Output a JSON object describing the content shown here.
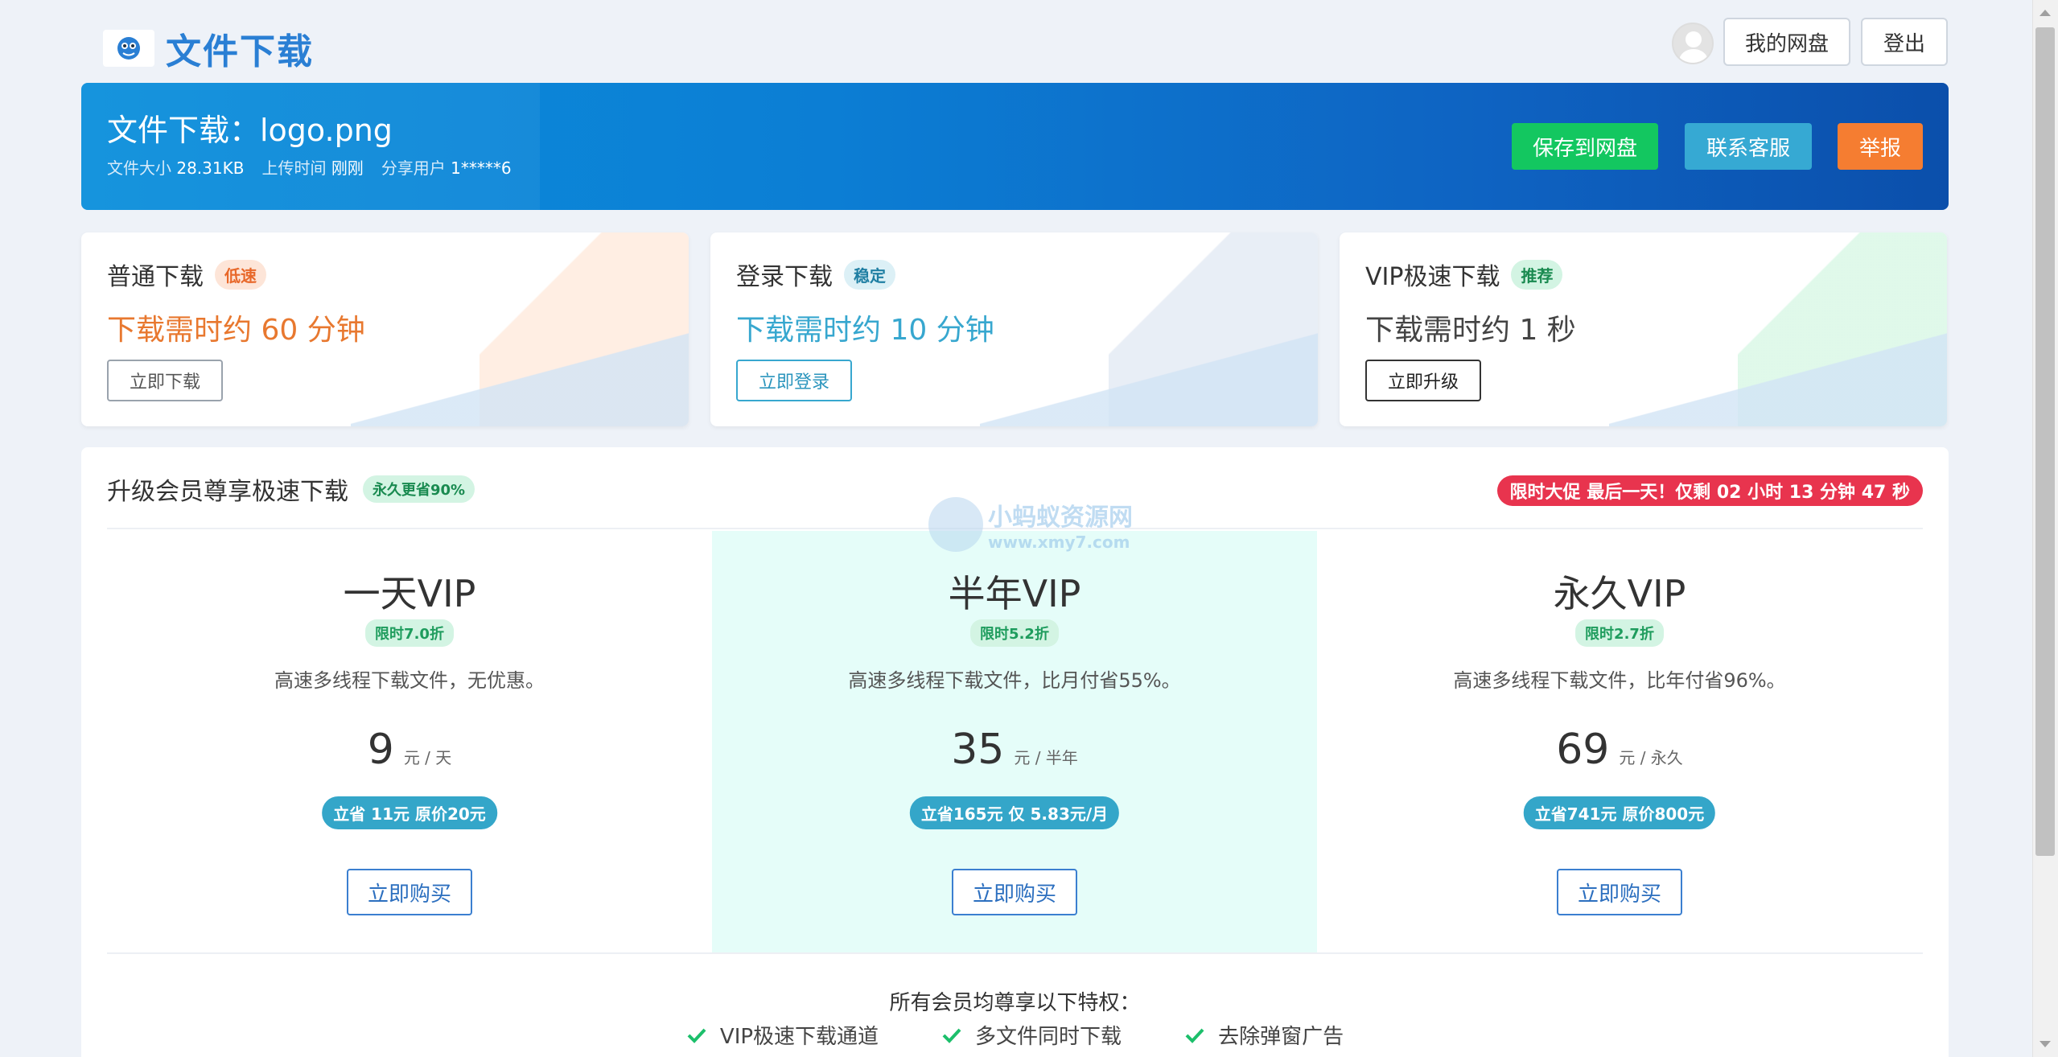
{
  "header": {
    "logo_text": "文件下载",
    "my_drive": "我的网盘",
    "logout": "登出"
  },
  "banner": {
    "title": "文件下载：logo.png",
    "size_label": "文件大小",
    "size_value": "28.31KB",
    "upload_label": "上传时间",
    "upload_value": "刚刚",
    "user_label": "分享用户",
    "user_value": "1*****6",
    "save_btn": "保存到网盘",
    "contact_btn": "联系客服",
    "report_btn": "举报",
    "colors": {
      "save": "#13c760",
      "contact": "#36a9d3",
      "report": "#f57d31"
    }
  },
  "download_options": [
    {
      "title": "普通下载",
      "tag": "低速",
      "time": "下载需时约 60 分钟",
      "button": "立即下载",
      "tag_bg": "#fde5d8",
      "tag_color": "#e8682a",
      "time_color": "#e8782f"
    },
    {
      "title": "登录下载",
      "tag": "稳定",
      "time": "下载需时约 10 分钟",
      "button": "立即登录",
      "tag_bg": "#dcf0f6",
      "tag_color": "#1f7fa3",
      "time_color": "#37a7cf"
    },
    {
      "title": "VIP极速下载",
      "tag": "推荐",
      "time": "下载需时约 1 秒",
      "button": "立即升级",
      "tag_bg": "#d3f4e3",
      "tag_color": "#198a50",
      "time_color": "#444444"
    }
  ],
  "plans": {
    "title": "升级会员尊享极速下载",
    "title_tag": "永久更省90%",
    "promo": "限时大促 最后一天！仅剩 02 小时 13 分钟 47 秒",
    "items": [
      {
        "name": "一天VIP",
        "discount": "限时7.0折",
        "desc": "高速多线程下载文件，无优惠。",
        "price": "9",
        "unit": "元 / 天",
        "save": "立省 11元 原价20元",
        "buy": "立即购买"
      },
      {
        "name": "半年VIP",
        "discount": "限时5.2折",
        "desc": "高速多线程下载文件，比月付省55%。",
        "price": "35",
        "unit": "元 / 半年",
        "save": "立省165元 仅 5.83元/月",
        "buy": "立即购买"
      },
      {
        "name": "永久VIP",
        "discount": "限时2.7折",
        "desc": "高速多线程下载文件，比年付省96%。",
        "price": "69",
        "unit": "元 / 永久",
        "save": "立省741元 原价800元",
        "buy": "立即购买"
      }
    ],
    "perks_title": "所有会员均尊享以下特权：",
    "perks": [
      "VIP极速下载通道",
      "多文件同时下载",
      "去除弹窗广告"
    ]
  },
  "watermark": {
    "name": "小蚂蚁资源网",
    "url": "www.xmy7.com"
  }
}
